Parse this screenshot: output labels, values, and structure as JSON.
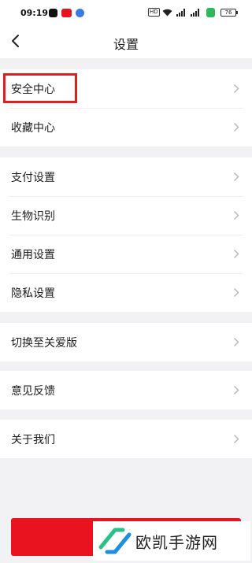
{
  "status_bar": {
    "time": "09:19",
    "network_badge": "HD",
    "battery_level": "76"
  },
  "header": {
    "title": "设置"
  },
  "settings_groups": [
    {
      "items": [
        {
          "label": "安全中心"
        },
        {
          "label": "收藏中心"
        }
      ]
    },
    {
      "items": [
        {
          "label": "支付设置"
        },
        {
          "label": "生物识别"
        },
        {
          "label": "通用设置"
        },
        {
          "label": "隐私设置"
        }
      ]
    },
    {
      "items": [
        {
          "label": "切换至关爱版"
        }
      ]
    },
    {
      "items": [
        {
          "label": "意见反馈"
        }
      ]
    },
    {
      "items": [
        {
          "label": "关于我们"
        }
      ]
    }
  ],
  "watermark": {
    "text": "欧凯手游网"
  },
  "colors": {
    "accent_red": "#e8131f",
    "highlight_box": "#e02020",
    "watermark_green": "#2bbf8a",
    "watermark_blue": "#1e8fe0"
  }
}
